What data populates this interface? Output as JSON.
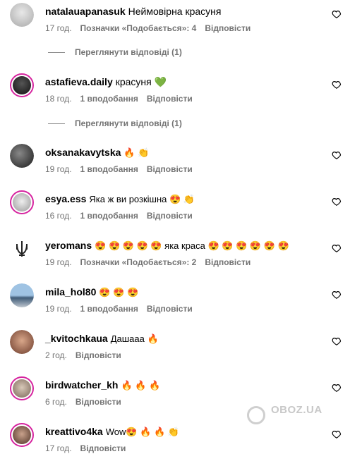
{
  "comments": [
    {
      "user": "natalauapanasuk",
      "text": "Неймовірна красуня",
      "time": "17 год.",
      "likes": "Позначки «Подобається»: 4",
      "reply": "Відповісти"
    },
    {
      "user": "astafieva.daily",
      "text": "красуня 💚",
      "time": "18 год.",
      "likes": "1 вподобання",
      "reply": "Відповісти"
    },
    {
      "user": "oksanakavytska",
      "text": "🔥 👏",
      "time": "19 год.",
      "likes": "1 вподобання",
      "reply": "Відповісти"
    },
    {
      "user": "esya.ess",
      "text": "Яка ж ви розкішна 😍 👏",
      "time": "16 год.",
      "likes": "1 вподобання",
      "reply": "Відповісти"
    },
    {
      "user": "yeromans",
      "text": "😍 😍 😍 😍 😍 яка краса 😍 😍 😍 😍 😍 😍",
      "time": "19 год.",
      "likes": "Позначки «Подобається»: 2",
      "reply": "Відповісти"
    },
    {
      "user": "mila_hol80",
      "text": "😍 😍 😍",
      "time": "19 год.",
      "likes": "1 вподобання",
      "reply": "Відповісти"
    },
    {
      "user": "_kvitochkaua",
      "text": "Дашааа 🔥",
      "time": "2 год.",
      "reply": "Відповісти"
    },
    {
      "user": "birdwatcher_kh",
      "text": "🔥 🔥 🔥",
      "time": "6 год.",
      "reply": "Відповісти"
    },
    {
      "user": "kreattivo4ka",
      "text": "Wow😍 🔥 🔥 👏",
      "time": "17 год.",
      "reply": "Відповісти"
    }
  ],
  "view_replies": [
    "Переглянути відповіді (1)",
    "Переглянути відповіді (1)"
  ],
  "watermark": "OBOZ.UA",
  "colors": {
    "accent_ring": "#d6249f",
    "secondary_text": "#737373"
  },
  "icons": {
    "like": "heart-outline-icon"
  }
}
